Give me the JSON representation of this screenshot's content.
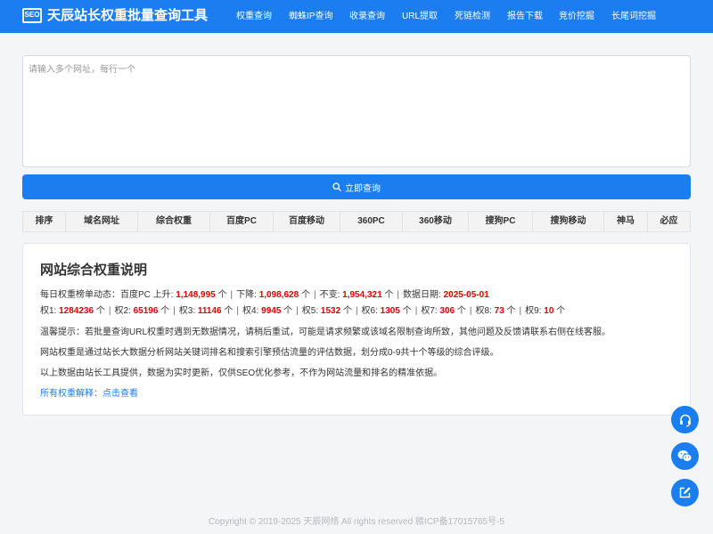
{
  "header": {
    "logo_text": "SEO",
    "title": "天辰站长权重批量查询工具",
    "nav": [
      "权重查询",
      "蜘蛛IP查询",
      "收录查询",
      "URL提取",
      "死链检测",
      "报告下载",
      "竞价挖掘",
      "长尾词挖掘"
    ]
  },
  "input": {
    "placeholder": "请输入多个网址，每行一个",
    "value": ""
  },
  "query_button": {
    "label": "立即查询",
    "icon": "search-icon"
  },
  "table": {
    "columns": [
      "排序",
      "域名网址",
      "综合权重",
      "百度PC",
      "百度移动",
      "360PC",
      "360移动",
      "搜狗PC",
      "搜狗移动",
      "神马",
      "必应"
    ]
  },
  "info": {
    "title": "网站综合权重说明",
    "trend_prefix": "每日权重榜单动态：百度PC 上升: ",
    "up": "1,148,995",
    "down_prefix": "下降: ",
    "down": "1,098,628",
    "same_prefix": "不变: ",
    "same": "1,954,321",
    "date_prefix": "数据日期: ",
    "date": "2025-05-01",
    "unit": "个",
    "separator": "|",
    "weights": [
      {
        "label": "权1: ",
        "value": "1284236"
      },
      {
        "label": "权2: ",
        "value": "65196"
      },
      {
        "label": "权3: ",
        "value": "11146"
      },
      {
        "label": "权4: ",
        "value": "9945"
      },
      {
        "label": "权5: ",
        "value": "1532"
      },
      {
        "label": "权6: ",
        "value": "1305"
      },
      {
        "label": "权7: ",
        "value": "306"
      },
      {
        "label": "权8: ",
        "value": "73"
      },
      {
        "label": "权9: ",
        "value": "10"
      }
    ],
    "tip": "温馨提示：若批量查询URL权重时遇到无数据情况，请稍后重试，可能是请求频繁或该域名限制查询所致，其他问题及反馈请联系右侧在线客服。",
    "desc": "网站权重是通过站长大数据分析网站关键词排名和搜索引擎预估流量的评估数据，划分成0-9共十个等级的综合评级。",
    "source": "以上数据由站长工具提供，数据为实时更新，仅供SEO优化参考，不作为网站流量和排名的精准依据。",
    "explain_prefix": "所有权重解释：",
    "explain_link": "点击查看"
  },
  "float_buttons": [
    "headset-icon",
    "wechat-icon",
    "edit-icon"
  ],
  "footer": "Copyright © 2019-2025 天辰网络 All rights reserved 赣ICP备17015765号-5",
  "colors": {
    "primary": "#1a7ef0",
    "highlight": "#e00000",
    "background": "#f4f5f7"
  }
}
